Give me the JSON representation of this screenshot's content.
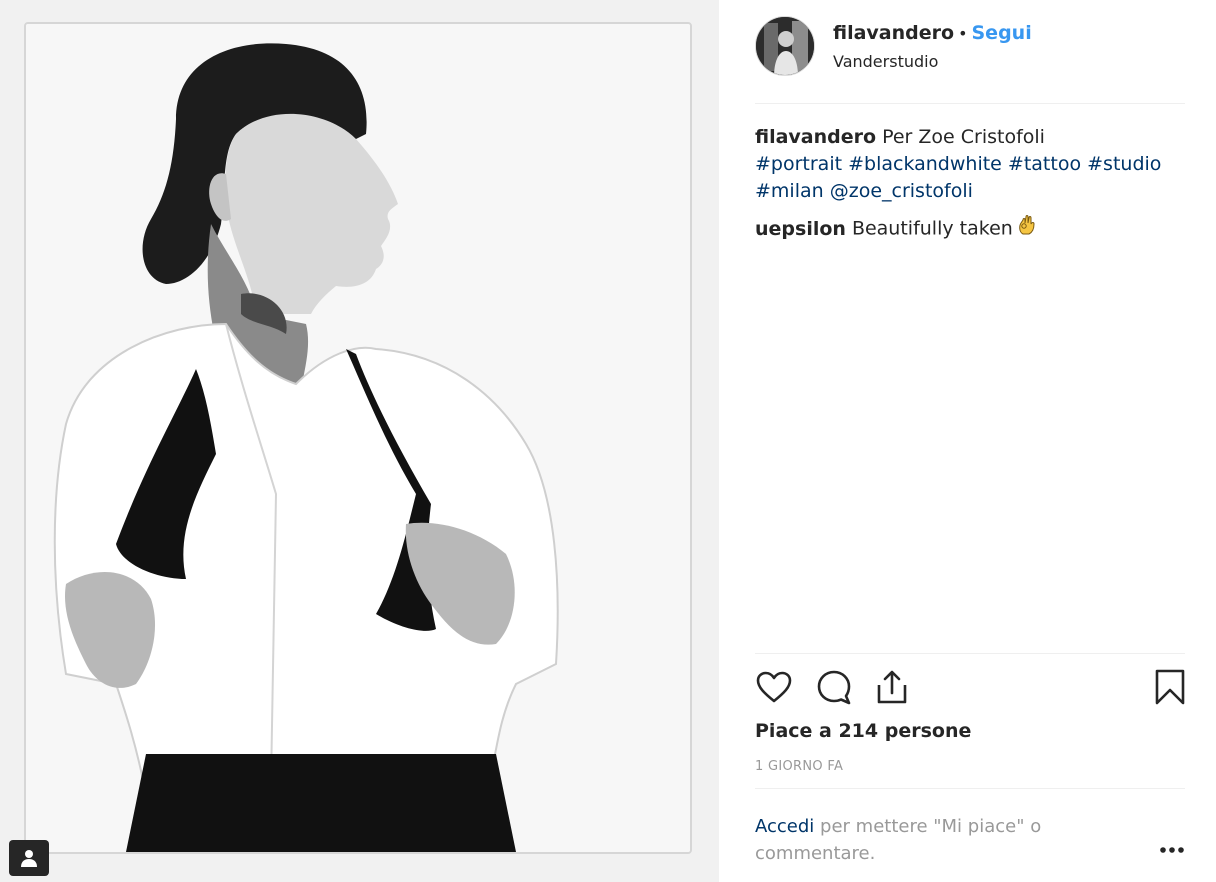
{
  "post": {
    "username": "filavandero",
    "separator": "•",
    "follow_label": "Segui",
    "location": "Vanderstudio"
  },
  "caption": {
    "username": "filavandero",
    "text": "Per Zoe Cristofoli",
    "tags": [
      "#portrait",
      "#blackandwhite",
      "#tattoo",
      "#studio",
      "#milan",
      "@zoe_cristofoli"
    ]
  },
  "comments": [
    {
      "username": "uepsilon",
      "text": "Beautifully taken",
      "emoji": "ok-hand-emoji"
    }
  ],
  "actions": {
    "like_icon": "heart-icon",
    "comment_icon": "comment-bubble-icon",
    "share_icon": "share-icon",
    "save_icon": "bookmark-icon"
  },
  "likes_label": "Piace a 214 persone",
  "timestamp": "1 GIORNO FA",
  "login_prompt": {
    "link": "Accedi",
    "text": "per mettere \"Mi piace\" o commentare."
  },
  "more_label": "•••",
  "colors": {
    "link_blue": "#3897f0",
    "hashtag": "#003569",
    "muted": "#999999",
    "text": "#262626"
  }
}
